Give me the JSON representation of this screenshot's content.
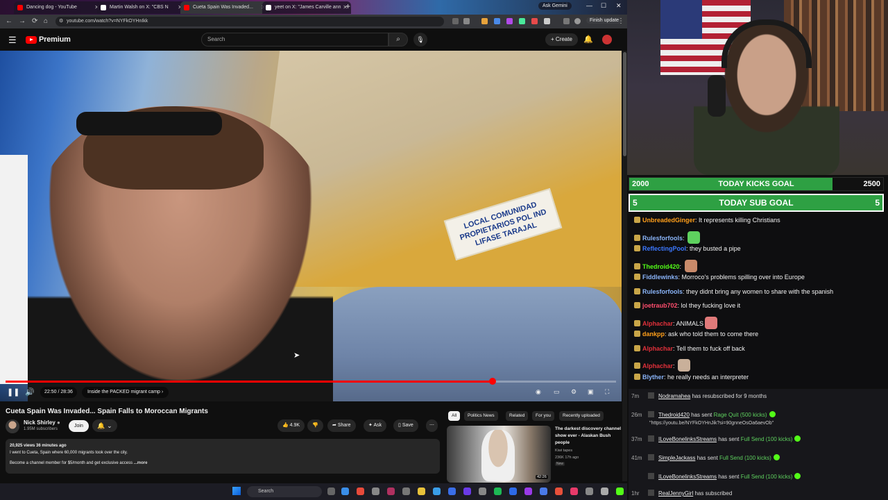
{
  "browser": {
    "tabs": [
      {
        "title": "Dancing dog - YouTube",
        "color": "#ff0000",
        "active": false
      },
      {
        "title": "Martin Walsh on X: \"CBS N",
        "color": "#ffffff",
        "active": false
      },
      {
        "title": "Cueta Spain Was Invaded...",
        "color": "#ff0000",
        "active": true
      },
      {
        "title": "yeet on X: \"James Carville ann",
        "color": "#ffffff",
        "active": false
      }
    ],
    "ask_gemini": "Ask Gemini",
    "url": "youtube.com/watch?v=NYFkOYHnIkk",
    "finish_update": "Finish update"
  },
  "youtube": {
    "logo_text": "Premium",
    "search_placeholder": "Search",
    "create_label": "Create",
    "player": {
      "time": "22:50 / 28:36",
      "chapter": "Inside the PACKED migrant camp",
      "progress_fraction": 0.798,
      "sign_text": "LOCAL COMUNIDAD PROPIETARIOS POL IND LIFASE TARAJAL"
    },
    "video_title": "Cueta Spain Was Invaded... Spain Falls to Moroccan Migrants",
    "channel": {
      "name": "Nick Shirley",
      "subscribers": "1.95M subscribers"
    },
    "join_label": "Join",
    "actions": {
      "likes": "4.9K",
      "share": "Share",
      "ask": "Ask",
      "save": "Save"
    },
    "description": {
      "meta": "20,925 views  36 minutes ago",
      "line1": "I went to Cueta, Spain where 60,000 migrants took over the city.",
      "line2": "Become a channel member for $5/month and get exclusive access",
      "more": "...more"
    },
    "chips": [
      "All",
      "Politics News",
      "Related",
      "For you",
      "Recently uploaded"
    ],
    "recommended": {
      "title": "The darkest discovery channel show ever - Alaskan Bush people",
      "channel": "Kiwi tapes",
      "meta": "236K  17h ago",
      "badge": "New",
      "duration": "42:26"
    }
  },
  "taskbar": {
    "search_placeholder": "Search"
  },
  "stream": {
    "kicks_goal": {
      "left": "2000",
      "label": "TODAY KICKS GOAL",
      "right": "2500",
      "fraction": 0.8
    },
    "sub_goal": {
      "left": "5",
      "label": "TODAY SUB GOAL",
      "right": "5",
      "fraction": 1.0
    },
    "chat": [
      {
        "user": "UnbreadedGinger",
        "color": "#ff9f1a",
        "message": "It represents killing Christians"
      },
      {
        "user": "Rulesforfools",
        "color": "#8ab4f8",
        "message": ""
      },
      {
        "user": "ReflectingPool",
        "color": "#3c78ff",
        "message": "they busted a pipe"
      },
      {
        "user": "Thedroid420",
        "color": "#53fc18",
        "message": ""
      },
      {
        "user": "Fiddlewinks",
        "color": "#8ab4f8",
        "message": "Morroco's problems spilling over into Europe"
      },
      {
        "user": "Rulesforfools",
        "color": "#8ab4f8",
        "message": "they didnt bring any women to share with the spanish"
      },
      {
        "user": "joetraub702",
        "color": "#ff4d6d",
        "message": "lol they fucking love it"
      },
      {
        "user": "Alphachar",
        "color": "#e0303a",
        "message": "ANIMALS"
      },
      {
        "user": "dankpp",
        "color": "#ff9f1a",
        "message": "ask who told them to come there"
      },
      {
        "user": "Alphachar",
        "color": "#e0303a",
        "message": "Tell them to fuck off back"
      },
      {
        "user": "Alphachar",
        "color": "#e0303a",
        "message": ""
      },
      {
        "user": "Blyther",
        "color": "#8ab4f8",
        "message": "he really needs an interpreter"
      }
    ],
    "events": [
      {
        "time": "7m",
        "user": "Nodramahea",
        "text": "has resubscribed for 9 months",
        "highlight": ""
      },
      {
        "time": "26m",
        "user": "Thedroid420",
        "text": "has sent",
        "highlight": "Rage Quit (500 kicks)"
      },
      {
        "time": "",
        "user": "",
        "text": "\"https://youtu.be/NYFkOYHnJik?si=90gnneOsOa6aevOb\"",
        "highlight": ""
      },
      {
        "time": "37m",
        "user": "ILoveBonelinksStreams",
        "text": "has sent",
        "highlight": "Full Send (100 kicks)"
      },
      {
        "time": "41m",
        "user": "SimpleJackass",
        "text": "has sent",
        "highlight": "Full Send (100 kicks)"
      },
      {
        "time": "",
        "user": "ILoveBonelinksStreams",
        "text": "has sent",
        "highlight": "Full Send (100 kicks)"
      },
      {
        "time": "1hr",
        "user": "RealJennyGirl",
        "text": "has subscribed",
        "highlight": ""
      }
    ]
  }
}
